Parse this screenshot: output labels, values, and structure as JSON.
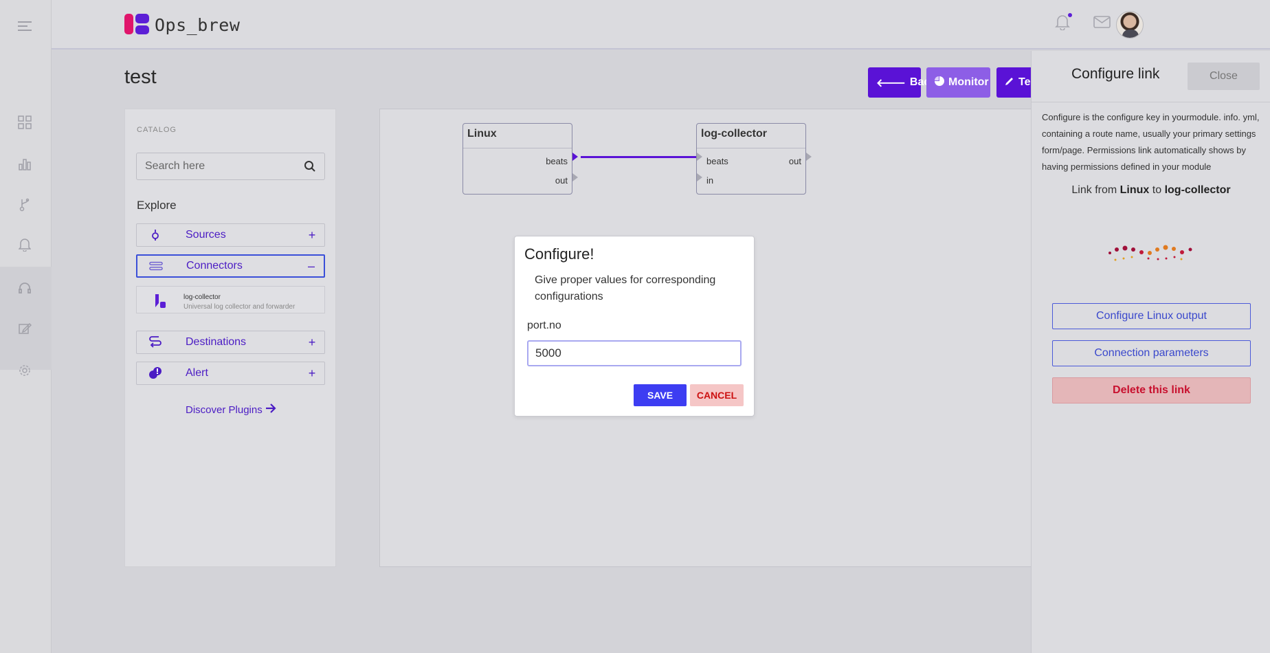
{
  "app": {
    "brand_name": "Ops_brew",
    "page_title": "test"
  },
  "toolbar": {
    "back_label": "Back",
    "monitor_label": "Monitor",
    "test_label": "Tes"
  },
  "catalog": {
    "title": "CATALOG",
    "search_placeholder": "Search here",
    "explore_label": "Explore",
    "items": [
      {
        "label": "Sources",
        "toggle": "+"
      },
      {
        "label": "Connectors",
        "toggle": "–"
      },
      {
        "label": "Destinations",
        "toggle": "+"
      },
      {
        "label": "Alert",
        "toggle": "+"
      }
    ],
    "connector_sub": {
      "name": "log-collector",
      "description": "Universal log collector and forwarder"
    },
    "discover_label": "Discover Plugins"
  },
  "canvas": {
    "nodes": [
      {
        "title": "Linux",
        "ports": [
          "beats",
          "out"
        ]
      },
      {
        "title": "log-collector",
        "ports_in": [
          "beats",
          "in"
        ],
        "ports_out": [
          "out"
        ]
      }
    ]
  },
  "modal": {
    "title": "Configure!",
    "description": "Give proper values for corresponding configurations",
    "field_label": "port.no",
    "field_value": "5000",
    "save_label": "SAVE",
    "cancel_label": "CANCEL"
  },
  "right_panel": {
    "title": "Configure link",
    "close_label": "Close",
    "description": "Configure is the configure key in yourmodule. info. yml, containing a route name, usually your primary settings form/page. Permissions link automatically shows by having permissions defined in your module",
    "link_prefix": "Link from",
    "link_from": "Linux",
    "link_mid": "to",
    "link_to": "log-collector",
    "btn_configure_output": "Configure Linux output",
    "btn_connection_params": "Connection parameters",
    "btn_delete": "Delete this link"
  },
  "colors": {
    "accent": "#5a12d6",
    "monitor": "#8d5ee6",
    "save": "#3d3df2",
    "danger": "#cc1111"
  }
}
